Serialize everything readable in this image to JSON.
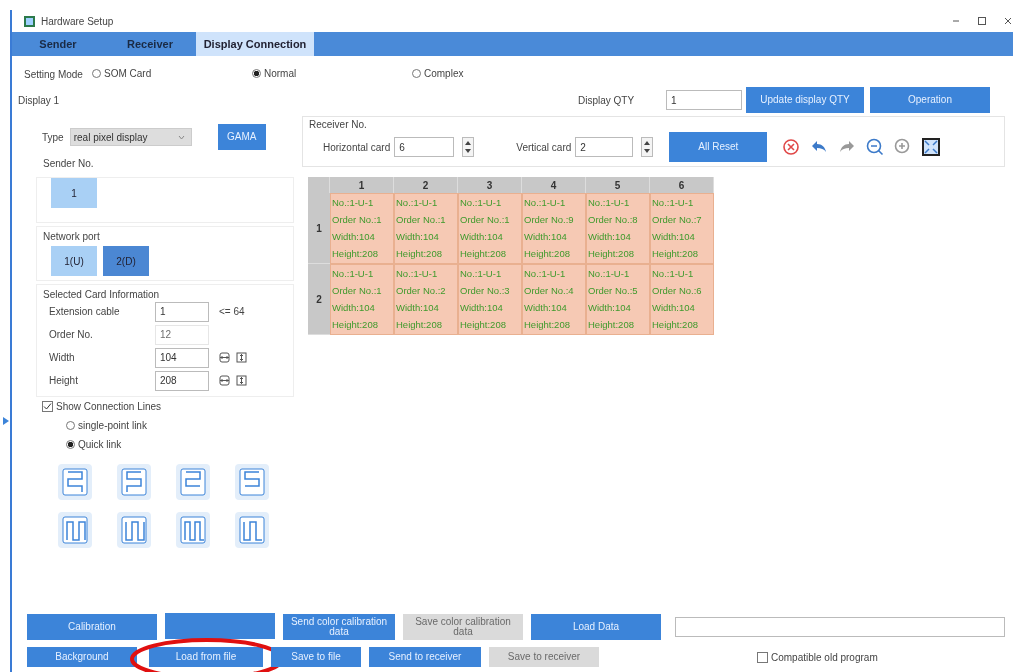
{
  "window": {
    "title": "Hardware Setup"
  },
  "tabs": [
    {
      "label": "Sender",
      "selected": false
    },
    {
      "label": "Receiver",
      "selected": false
    },
    {
      "label": "Display Connection",
      "selected": true
    }
  ],
  "setting_mode": {
    "label": "Setting Mode",
    "options": [
      {
        "label": "SOM Card",
        "selected": false
      },
      {
        "label": "Normal",
        "selected": true
      },
      {
        "label": "Complex",
        "selected": false
      }
    ]
  },
  "display_label": "Display 1",
  "display_qty": {
    "label": "Display QTY",
    "value": "1"
  },
  "top_buttons": [
    "Update display QTY",
    "Operation"
  ],
  "type": {
    "label": "Type",
    "value": "real pixel display"
  },
  "gama_button": "GAMA",
  "sender": {
    "label": "Sender No.",
    "items": [
      "1"
    ]
  },
  "network_port": {
    "label": "Network port",
    "items": [
      {
        "label": "1(U)",
        "selected": false
      },
      {
        "label": "2(D)",
        "selected": true
      }
    ]
  },
  "card_info": {
    "title": "Selected Card Information",
    "fields": [
      {
        "kind": "text",
        "label": "Extension cable",
        "value": "1",
        "note": "<= 64"
      },
      {
        "kind": "readonly",
        "label": "Order No.",
        "value": "12"
      },
      {
        "kind": "size",
        "label": "Width",
        "value": "104"
      },
      {
        "kind": "size",
        "label": "Height",
        "value": "208"
      }
    ]
  },
  "show_lines": {
    "label": "Show Connection Lines",
    "checked": true
  },
  "link_modes": [
    {
      "label": "single-point link",
      "selected": false
    },
    {
      "label": "Quick link",
      "selected": true
    }
  ],
  "receiver": {
    "title": "Receiver No.",
    "horizontal": {
      "label": "Horizontal card",
      "value": "6"
    },
    "vertical": {
      "label": "Vertical card",
      "value": "2"
    },
    "reset_button": "All Reset"
  },
  "grid": {
    "columns": [
      "1",
      "2",
      "3",
      "4",
      "5",
      "6"
    ],
    "rows": [
      {
        "label": "1",
        "cells": [
          {
            "no": "No.:1-U-1",
            "order": "Order No.:1",
            "width": "Width:104",
            "height": "Height:208"
          },
          {
            "no": "No.:1-U-1",
            "order": "Order No.:1",
            "width": "Width:104",
            "height": "Height:208"
          },
          {
            "no": "No.:1-U-1",
            "order": "Order No.:1",
            "width": "Width:104",
            "height": "Height:208"
          },
          {
            "no": "No.:1-U-1",
            "order": "Order No.:9",
            "width": "Width:104",
            "height": "Height:208"
          },
          {
            "no": "No.:1-U-1",
            "order": "Order No.:8",
            "width": "Width:104",
            "height": "Height:208"
          },
          {
            "no": "No.:1-U-1",
            "order": "Order No.:7",
            "width": "Width:104",
            "height": "Height:208"
          }
        ]
      },
      {
        "label": "2",
        "cells": [
          {
            "no": "No.:1-U-1",
            "order": "Order No.:1",
            "width": "Width:104",
            "height": "Height:208"
          },
          {
            "no": "No.:1-U-1",
            "order": "Order No.:2",
            "width": "Width:104",
            "height": "Height:208"
          },
          {
            "no": "No.:1-U-1",
            "order": "Order No.:3",
            "width": "Width:104",
            "height": "Height:208"
          },
          {
            "no": "No.:1-U-1",
            "order": "Order No.:4",
            "width": "Width:104",
            "height": "Height:208"
          },
          {
            "no": "No.:1-U-1",
            "order": "Order No.:5",
            "width": "Width:104",
            "height": "Height:208"
          },
          {
            "no": "No.:1-U-1",
            "order": "Order No.:6",
            "width": "Width:104",
            "height": "Height:208"
          }
        ]
      }
    ]
  },
  "bottom_rows": [
    [
      {
        "label": "Calibration",
        "disabled": false
      },
      {
        "disabled": false
      },
      {
        "label": "Send color calibration data",
        "disabled": false
      },
      {
        "label": "Save color calibration data",
        "disabled": true
      },
      {
        "label": "Load Data",
        "disabled": false
      }
    ],
    [
      {
        "label": "Background",
        "disabled": false
      },
      {
        "label": "Load from file",
        "disabled": false,
        "circled": true
      },
      {
        "label": "Save to file",
        "disabled": false
      },
      {
        "label": "Send to receiver",
        "disabled": false
      },
      {
        "label": "Save to receiver",
        "disabled": true
      }
    ]
  ],
  "compatible": {
    "label": "Compatible old program",
    "checked": false
  }
}
